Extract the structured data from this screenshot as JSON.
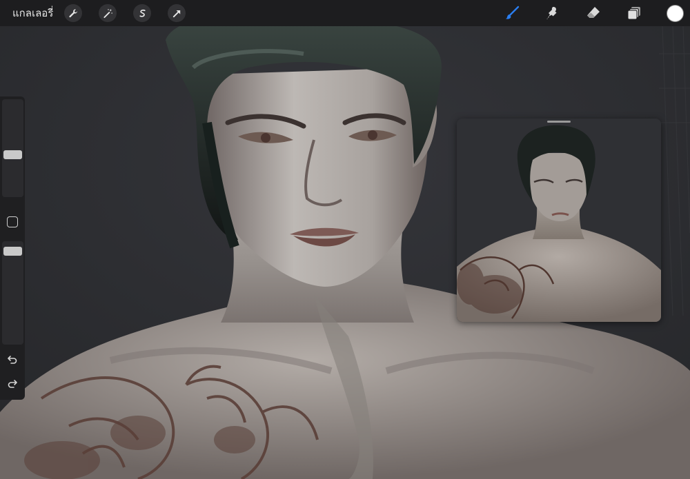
{
  "toolbar": {
    "gallery_label": "แกลเลอรี่",
    "left_tools": [
      {
        "icon": "wrench-icon",
        "name": "actions"
      },
      {
        "icon": "magic-wand-icon",
        "name": "adjustments"
      },
      {
        "icon": "selection-s-icon",
        "name": "selection"
      },
      {
        "icon": "arrow-cursor-icon",
        "name": "transform"
      }
    ],
    "right_tools": [
      {
        "icon": "brush-icon",
        "name": "paint",
        "active": true
      },
      {
        "icon": "smudge-icon",
        "name": "smudge"
      },
      {
        "icon": "eraser-icon",
        "name": "erase"
      },
      {
        "icon": "layers-icon",
        "name": "layers"
      }
    ],
    "current_color": "#ffffff",
    "active_color": "#2a7ef0"
  },
  "sidebar": {
    "brush_size_level": 0.45,
    "opacity_level": 0.1,
    "icons": [
      "modify-square-icon",
      "undo-icon",
      "redo-icon"
    ]
  },
  "reference": {
    "visible": true
  }
}
